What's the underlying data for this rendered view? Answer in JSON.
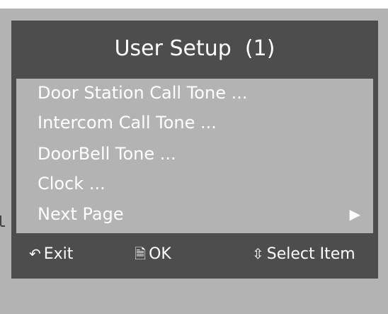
{
  "screen": {
    "title": "User Setup  (1)"
  },
  "menu": {
    "items": [
      {
        "label": "Door Station Call Tone ..."
      },
      {
        "label": "Intercom Call Tone ..."
      },
      {
        "label": "DoorBell Tone ..."
      },
      {
        "label": "Clock ..."
      },
      {
        "label": "Next Page",
        "arrow": "▶"
      }
    ]
  },
  "footer": {
    "exit_icon": "↶",
    "exit_label": "Exit",
    "ok_icon": "🗎",
    "ok_label": "OK",
    "select_icon": "⇳",
    "select_label": "Select Item"
  },
  "icons": {
    "exit": "return-arrow-icon",
    "ok": "document-icon",
    "select": "up-down-arrow-icon",
    "next": "play-triangle-icon"
  },
  "colors": {
    "bezel": "#b3b3b3",
    "screen": "#4d4d4d",
    "menu_background": "#b3b3b3",
    "text": "#ffffff"
  }
}
